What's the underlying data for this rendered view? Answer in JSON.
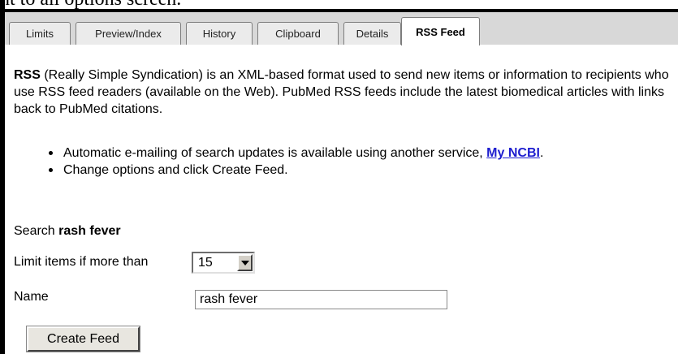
{
  "header_text": "nt to all options screen.",
  "tabs": [
    {
      "label": "Limits",
      "active": false
    },
    {
      "label": "Preview/Index",
      "active": false
    },
    {
      "label": "History",
      "active": false
    },
    {
      "label": "Clipboard",
      "active": false
    },
    {
      "label": "Details",
      "active": false
    },
    {
      "label": "RSS Feed",
      "active": true
    }
  ],
  "intro": {
    "term": "RSS",
    "text": " (Really Simple Syndication) is an XML-based format used to send new items or information to recipients who use RSS feed readers (available on the Web). PubMed RSS feeds include the latest biomedical articles with links back to PubMed citations."
  },
  "bullets": {
    "item1_prefix": "Automatic e-mailing of search updates is available using another service, ",
    "item1_link": "My NCBI",
    "item1_suffix": ".",
    "item2": "Change options and click Create Feed."
  },
  "search": {
    "label": "Search ",
    "term": "rash fever"
  },
  "limit": {
    "label": "Limit items if more than",
    "selected": "15"
  },
  "name": {
    "label": "Name",
    "value": "rash fever"
  },
  "create_button": "Create Feed",
  "colors": {
    "link": "#1d1dcf",
    "tab_strip": "#d8d8d8"
  }
}
